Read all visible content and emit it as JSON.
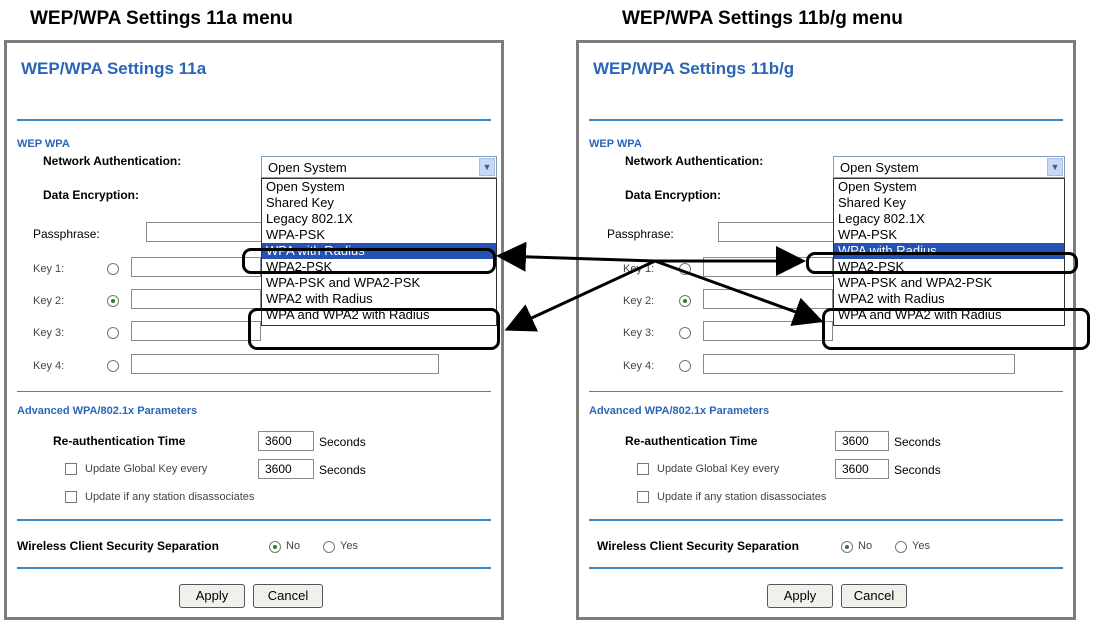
{
  "captions": {
    "left": "WEP/WPA Settings 11a menu",
    "right": "WEP/WPA Settings 11b/g menu"
  },
  "panels": {
    "left": {
      "title": "WEP/WPA Settings 11a",
      "section_wepwpa": "WEP WPA",
      "network_auth_label": "Network Authentication:",
      "network_auth_value": "Open System",
      "data_encryption_label": "Data Encryption:",
      "passphrase_label": "Passphrase:",
      "keys": [
        "Key 1:",
        "Key 2:",
        "Key 3:",
        "Key 4:"
      ],
      "selected_key_index": 1,
      "options": [
        "Open System",
        "Shared Key",
        "Legacy 802.1X",
        "WPA-PSK",
        "WPA with Radius",
        "WPA2-PSK",
        "WPA-PSK and WPA2-PSK",
        "WPA2 with Radius",
        "WPA and WPA2 with Radius"
      ],
      "highlighted_option": "WPA with Radius",
      "advanced_section": "Advanced WPA/802.1x Parameters",
      "reauth_label": "Re-authentication Time",
      "reauth_value": "3600",
      "reauth_unit": "Seconds",
      "update_global_label": "Update Global Key every",
      "update_global_value": "3600",
      "update_global_unit": "Seconds",
      "update_station_label": "Update if any station disassociates",
      "separation_label": "Wireless Client Security Separation",
      "separation_no": "No",
      "separation_yes": "Yes",
      "apply": "Apply",
      "cancel": "Cancel"
    },
    "right": {
      "title": "WEP/WPA Settings 11b/g",
      "section_wepwpa": "WEP WPA",
      "network_auth_label": "Network Authentication:",
      "network_auth_value": "Open System",
      "data_encryption_label": "Data Encryption:",
      "passphrase_label": "Passphrase:",
      "keys": [
        "Key 1:",
        "Key 2:",
        "Key 3:",
        "Key 4:"
      ],
      "selected_key_index": 1,
      "options": [
        "Open System",
        "Shared Key",
        "Legacy 802.1X",
        "WPA-PSK",
        "WPA with Radius",
        "WPA2-PSK",
        "WPA-PSK and WPA2-PSK",
        "WPA2 with Radius",
        "WPA and WPA2 with Radius"
      ],
      "highlighted_option": "WPA with Radius",
      "advanced_section": "Advanced WPA/802.1x Parameters",
      "reauth_label": "Re-authentication Time",
      "reauth_value": "3600",
      "reauth_unit": "Seconds",
      "update_global_label": "Update Global Key every",
      "update_global_value": "3600",
      "update_global_unit": "Seconds",
      "update_station_label": "Update if any station disassociates",
      "separation_label": "Wireless Client Security Separation",
      "separation_no": "No",
      "separation_yes": "Yes",
      "apply": "Apply",
      "cancel": "Cancel"
    }
  },
  "colors": {
    "accent_blue": "#2a66b8",
    "rule_blue": "#3a88c7",
    "selection": "#2452b7"
  }
}
